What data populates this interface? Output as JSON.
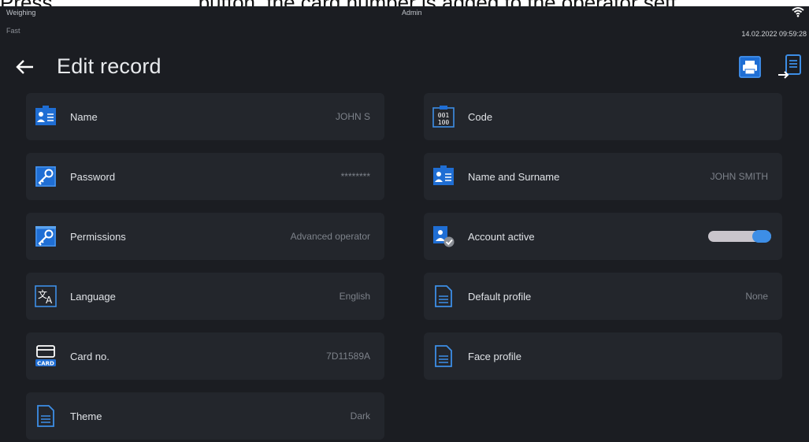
{
  "doc": {
    "line_start": "Press",
    "line_end": "button, the card number is added to the operator sett"
  },
  "status": {
    "mode": "Weighing",
    "speed": "Fast",
    "user": "Admin",
    "datetime": "14.02.2022 09:59:28"
  },
  "header": {
    "title": "Edit record"
  },
  "left_items": [
    {
      "label": "Name",
      "value": "JOHN S",
      "icon": "id-badge-icon"
    },
    {
      "label": "Password",
      "value": "********",
      "icon": "key-icon"
    },
    {
      "label": "Permissions",
      "value": "Advanced operator",
      "icon": "permissions-key-icon"
    },
    {
      "label": "Language",
      "value": "English",
      "icon": "translate-icon"
    },
    {
      "label": "Card no.",
      "value": "7D11589A",
      "icon": "card-icon",
      "icon_text": "CARD"
    },
    {
      "label": "Theme",
      "value": "Dark",
      "icon": "document-icon"
    }
  ],
  "right_items": [
    {
      "label": "Code",
      "value": "",
      "icon": "code-icon",
      "icon_text_top": "001",
      "icon_text_bottom": "100"
    },
    {
      "label": "Name and Surname",
      "value": "JOHN SMITH",
      "icon": "id-badge-icon"
    },
    {
      "label": "Account active",
      "value": "",
      "icon": "user-active-icon",
      "toggle_on": true
    },
    {
      "label": "Default profile",
      "value": "None",
      "icon": "document-icon"
    },
    {
      "label": "Face profile",
      "value": "",
      "icon": "document-icon"
    }
  ],
  "colors": {
    "background": "#1b1d22",
    "row": "#23262c",
    "accent": "#3d8ee6",
    "icon_accent": "#1f6ed4"
  }
}
